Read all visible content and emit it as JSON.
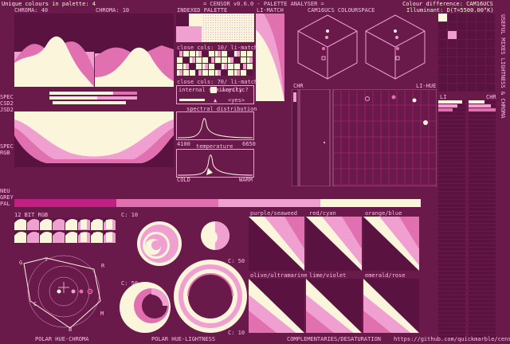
{
  "colors": {
    "bg": "#6a1a4a",
    "dark": "#5a1240",
    "cream": "#fbf5dc",
    "pink": "#f0a0d0",
    "mid": "#e070b0",
    "deep": "#c02080",
    "line": "#f0c0e0"
  },
  "header": {
    "unique_colours": "Unique colours in palette: 4",
    "chroma_left": "CHROMA: 40",
    "chroma_right": "CHROMA: 10",
    "title": "= CENSOR v0.6.0 - PALETTE ANALYSER =",
    "colour_difference": "Colour difference: CAM16UCS",
    "illuminant": "Illuminant: D(T=5500.00°K)"
  },
  "labels": {
    "indexed_palette": "INDEXED PALETTE",
    "li_match": "LI-MATCH",
    "cam16ucs": "CAM16UCS COLOURSPACE",
    "close_10": "close cols: 10/ li-match",
    "close_70": "close cols: 70/ li-match",
    "internal_similarity": "internal similarity",
    "acyclic": "acyclic?",
    "yes": "<yes>",
    "spectral": "spectral distribution",
    "spec_min": "4100",
    "spec_max": "6650",
    "temperature": "temperature",
    "cold": "COLD",
    "warm": "WARM",
    "chr": "CHR",
    "li_hue": "LI-HUE",
    "li": "LI",
    "chr2": "CHR",
    "spec": "SPEC",
    "csd2": "CSD2",
    "jsd2": "JSD2",
    "spec2": "SPEC",
    "rgb": "RGB",
    "neu": "NEU",
    "grey": "GREY",
    "pal": "PAL",
    "bit_rgb": "12 BIT RGB",
    "c10a": "C: 10",
    "c50a": "C: 50",
    "c50b": "C: 50",
    "c10b": "C: 10",
    "polar_hue_chroma": "POLAR HUE-CHROMA",
    "polar_hue_lightness": "POLAR HUE-LIGHTNESS",
    "complementaries": "COMPLEMENTARIES/DESATURATION",
    "github": "https://github.com/quickmarble/censor",
    "vertical": "USEFUL MIXES   LIGHTNESS & CHROMA"
  },
  "pairs": [
    "purple/seaweed",
    "red/cyan",
    "orange/blue",
    "olive/ultramarine",
    "lime/violet",
    "emerald/rose"
  ],
  "polar_letters": [
    "G",
    "Y",
    "R",
    "C",
    "B",
    "M"
  ]
}
